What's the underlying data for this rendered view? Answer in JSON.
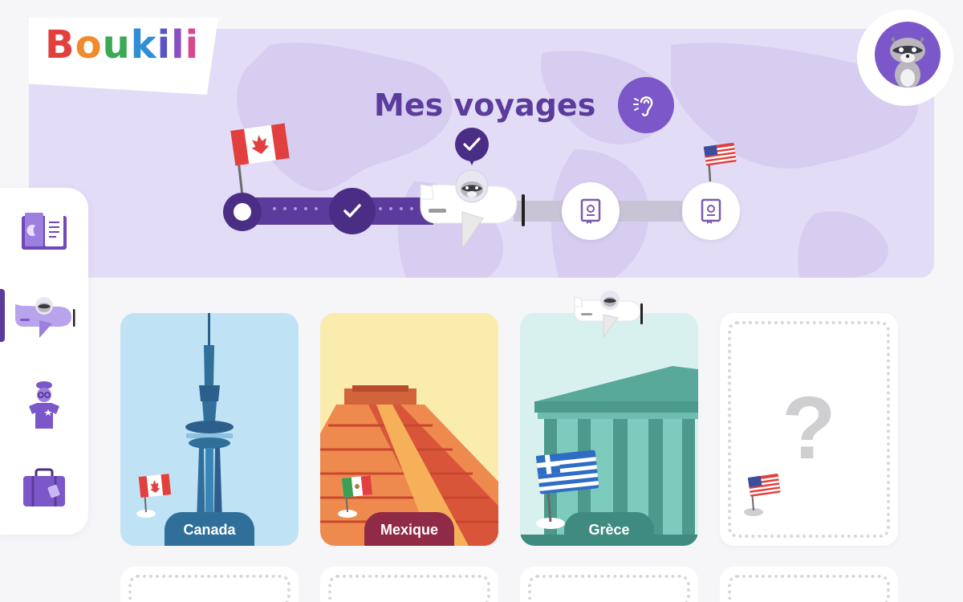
{
  "app": {
    "logo_letters": [
      {
        "char": "B",
        "color": "#e2403f"
      },
      {
        "char": "o",
        "color": "#f08a2c"
      },
      {
        "char": "u",
        "color": "#3aaa55"
      },
      {
        "char": "k",
        "color": "#2f8fd3"
      },
      {
        "char": "i",
        "color": "#5a55c7"
      },
      {
        "char": "l",
        "color": "#8a4fc4"
      },
      {
        "char": "i",
        "color": "#d9478e"
      }
    ]
  },
  "header": {
    "title": "Mes voyages",
    "listen_icon": "ear-icon"
  },
  "progress": {
    "steps": [
      "start",
      "done",
      "current",
      "book",
      "book"
    ],
    "completed_steps": 2,
    "current_step": 3,
    "total_steps": 5
  },
  "sidebar": {
    "items": [
      {
        "name": "books",
        "icon": "book-icon",
        "active": false
      },
      {
        "name": "voyages",
        "icon": "plane-icon",
        "active": true
      },
      {
        "name": "avatar-custom",
        "icon": "character-icon",
        "active": false
      },
      {
        "name": "suitcase",
        "icon": "suitcase-icon",
        "active": false
      }
    ]
  },
  "cards": [
    {
      "label": "Canada",
      "bg": "#bfe2f5",
      "label_color": "#2f6f9a"
    },
    {
      "label": "Mexique",
      "bg": "#f9ecad",
      "label_color": "#8f2a47"
    },
    {
      "label": "Grèce",
      "bg": "#d8f1ee",
      "label_color": "#3f8b80"
    },
    {
      "label": "?",
      "bg": "#ffffff",
      "label_color": ""
    }
  ],
  "colors": {
    "brand_purple": "#5b3c9c",
    "accent_purple": "#7b57c9",
    "banner_bg": "#e3dcf6"
  }
}
